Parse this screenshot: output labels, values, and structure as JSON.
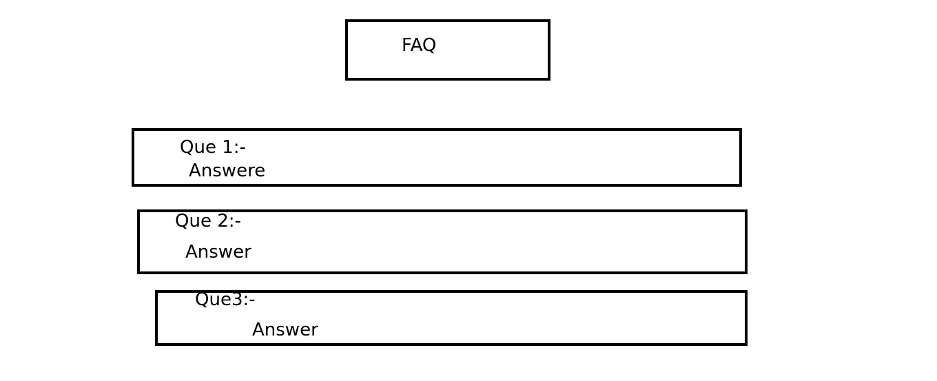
{
  "header": {
    "title": "FAQ"
  },
  "faq": [
    {
      "question": "Que 1:-",
      "answer": "Answere"
    },
    {
      "question": "Que 2:-",
      "answer": "Answer"
    },
    {
      "question": "Que3:-",
      "answer": "Answer"
    }
  ]
}
